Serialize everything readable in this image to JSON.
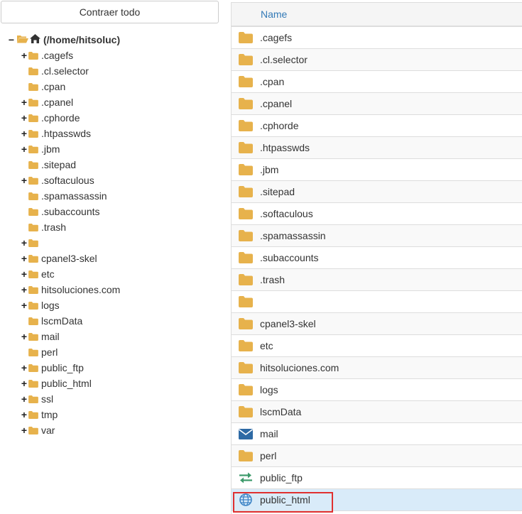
{
  "colors": {
    "folder": "#e7b24c",
    "link": "#337ab7",
    "selected_row": "#d9ebf9",
    "highlight_border": "#e03030",
    "mail_icon": "#2e6aa5",
    "ftp_icon": "#3c9a6a",
    "web_icon": "#3d84c6"
  },
  "tree": {
    "collapse_label": "Contraer todo",
    "root": {
      "toggle": "−",
      "label": "(/home/hitsoluc)",
      "icons": [
        "folder-open-icon",
        "home-icon"
      ]
    },
    "items": [
      {
        "label": ".cagefs",
        "expandable": true
      },
      {
        "label": ".cl.selector",
        "expandable": false
      },
      {
        "label": ".cpan",
        "expandable": false
      },
      {
        "label": ".cpanel",
        "expandable": true
      },
      {
        "label": ".cphorde",
        "expandable": true
      },
      {
        "label": ".htpasswds",
        "expandable": true
      },
      {
        "label": ".jbm",
        "expandable": true
      },
      {
        "label": ".sitepad",
        "expandable": false
      },
      {
        "label": ".softaculous",
        "expandable": true
      },
      {
        "label": ".spamassassin",
        "expandable": false
      },
      {
        "label": ".subaccounts",
        "expandable": false
      },
      {
        "label": ".trash",
        "expandable": false
      },
      {
        "label": "",
        "expandable": true
      },
      {
        "label": "cpanel3-skel",
        "expandable": true
      },
      {
        "label": "etc",
        "expandable": true
      },
      {
        "label": "hitsoluciones.com",
        "expandable": true
      },
      {
        "label": "logs",
        "expandable": true
      },
      {
        "label": "lscmData",
        "expandable": false
      },
      {
        "label": "mail",
        "expandable": true
      },
      {
        "label": "perl",
        "expandable": false
      },
      {
        "label": "public_ftp",
        "expandable": true
      },
      {
        "label": "public_html",
        "expandable": true
      },
      {
        "label": "ssl",
        "expandable": true
      },
      {
        "label": "tmp",
        "expandable": true
      },
      {
        "label": "var",
        "expandable": true
      }
    ],
    "toggle_symbol": "+"
  },
  "table": {
    "header_name": "Name",
    "rows": [
      {
        "name": ".cagefs",
        "icon": "folder-icon"
      },
      {
        "name": ".cl.selector",
        "icon": "folder-icon"
      },
      {
        "name": ".cpan",
        "icon": "folder-icon"
      },
      {
        "name": ".cpanel",
        "icon": "folder-icon"
      },
      {
        "name": ".cphorde",
        "icon": "folder-icon"
      },
      {
        "name": ".htpasswds",
        "icon": "folder-icon"
      },
      {
        "name": ".jbm",
        "icon": "folder-icon"
      },
      {
        "name": ".sitepad",
        "icon": "folder-icon"
      },
      {
        "name": ".softaculous",
        "icon": "folder-icon"
      },
      {
        "name": ".spamassassin",
        "icon": "folder-icon"
      },
      {
        "name": ".subaccounts",
        "icon": "folder-icon"
      },
      {
        "name": ".trash",
        "icon": "folder-icon"
      },
      {
        "name": "",
        "icon": "folder-icon"
      },
      {
        "name": "cpanel3-skel",
        "icon": "folder-icon"
      },
      {
        "name": "etc",
        "icon": "folder-icon"
      },
      {
        "name": "hitsoluciones.com",
        "icon": "folder-icon"
      },
      {
        "name": "logs",
        "icon": "folder-icon"
      },
      {
        "name": "lscmData",
        "icon": "folder-icon"
      },
      {
        "name": "mail",
        "icon": "mail-icon"
      },
      {
        "name": "perl",
        "icon": "folder-icon"
      },
      {
        "name": "public_ftp",
        "icon": "transfer-arrows-icon"
      },
      {
        "name": "public_html",
        "icon": "globe-icon",
        "selected": true
      }
    ]
  }
}
